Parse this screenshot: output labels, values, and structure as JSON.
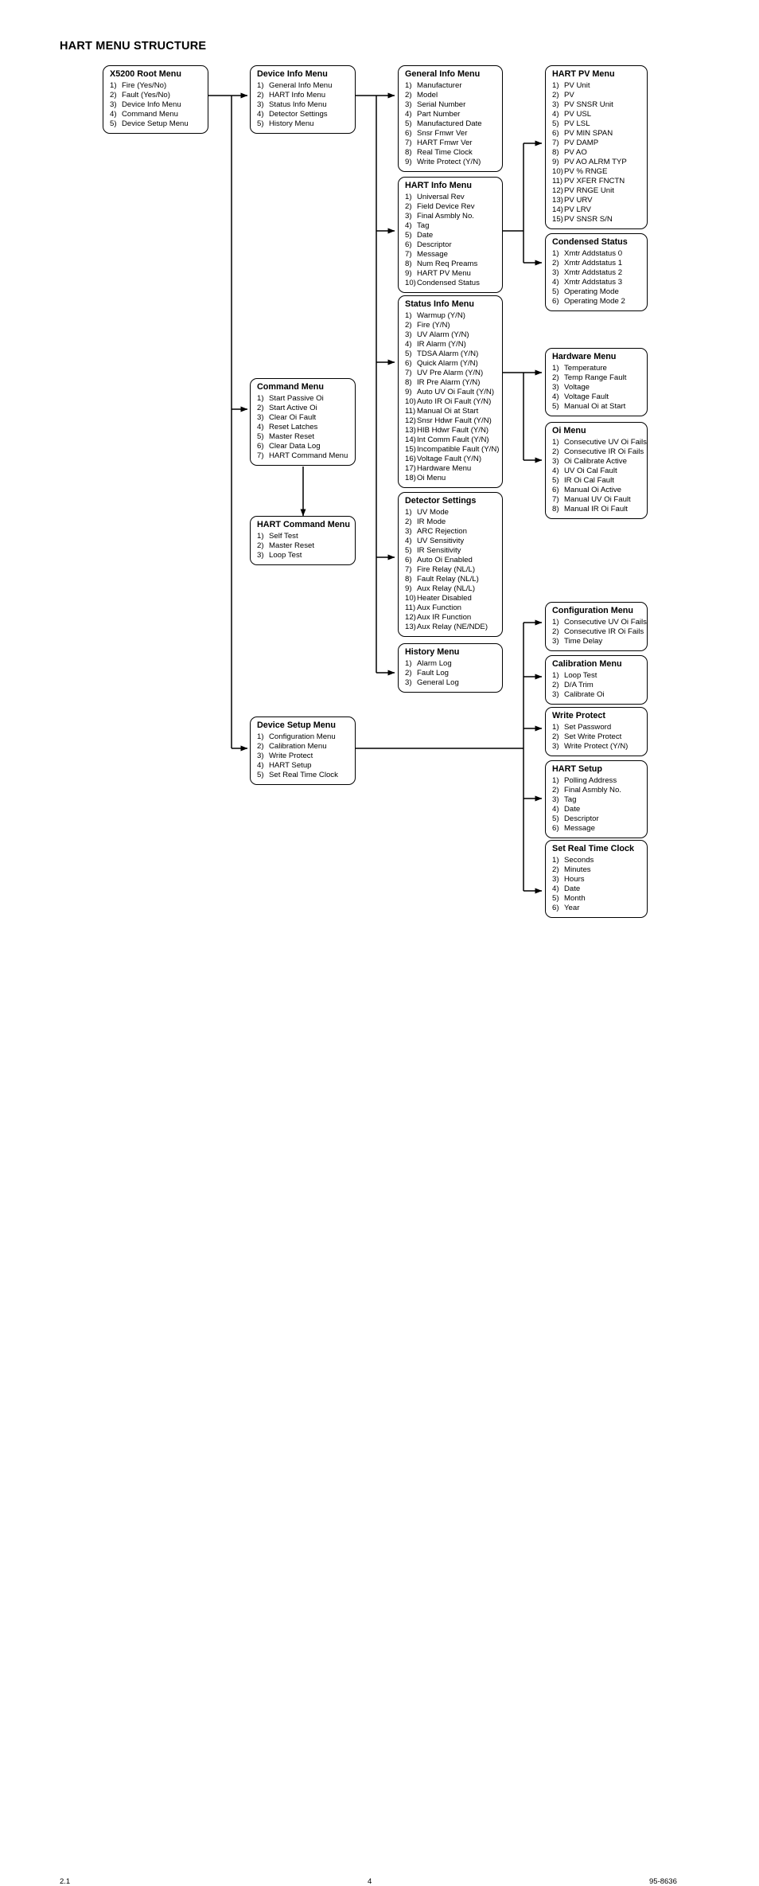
{
  "page": {
    "title": "HART MENU STRUCTURE",
    "footer": {
      "left": "2.1",
      "center": "4",
      "right": "95-8636"
    }
  },
  "diagram": {
    "type": "tree-menu-structure",
    "line_color": "#000000",
    "box_border_color": "#000000",
    "box_fill": "#ffffff",
    "nodes": [
      {
        "id": "root",
        "title": "X5200 Root Menu",
        "items": [
          {
            "num": "1)",
            "text": "Fire  (Yes/No)"
          },
          {
            "num": "2)",
            "text": "Fault  (Yes/No)"
          },
          {
            "num": "3)",
            "text": "Device Info Menu"
          },
          {
            "num": "4)",
            "text": "Command Menu"
          },
          {
            "num": "5)",
            "text": "Device Setup Menu"
          }
        ]
      },
      {
        "id": "device-info",
        "title": "Device Info Menu",
        "items": [
          {
            "num": "1)",
            "text": "General Info Menu"
          },
          {
            "num": "2)",
            "text": "HART Info Menu"
          },
          {
            "num": "3)",
            "text": "Status Info Menu"
          },
          {
            "num": "4)",
            "text": "Detector Settings"
          },
          {
            "num": "5)",
            "text": "History Menu"
          }
        ]
      },
      {
        "id": "general-info",
        "title": "General Info Menu",
        "items": [
          {
            "num": "1)",
            "text": "Manufacturer"
          },
          {
            "num": "2)",
            "text": "Model"
          },
          {
            "num": "3)",
            "text": "Serial Number"
          },
          {
            "num": "4)",
            "text": "Part Number"
          },
          {
            "num": "5)",
            "text": "Manufactured Date"
          },
          {
            "num": "6)",
            "text": "Snsr Fmwr Ver"
          },
          {
            "num": "7)",
            "text": "HART Fmwr Ver"
          },
          {
            "num": "8)",
            "text": "Real Time Clock"
          },
          {
            "num": "9)",
            "text": "Write Protect  (Y/N)"
          }
        ]
      },
      {
        "id": "hart-info",
        "title": "HART Info Menu",
        "items": [
          {
            "num": "1)",
            "text": "Universal Rev"
          },
          {
            "num": "2)",
            "text": "Field Device Rev"
          },
          {
            "num": "3)",
            "text": "Final Asmbly No."
          },
          {
            "num": "4)",
            "text": "Tag"
          },
          {
            "num": "5)",
            "text": "Date"
          },
          {
            "num": "6)",
            "text": "Descriptor"
          },
          {
            "num": "7)",
            "text": "Message"
          },
          {
            "num": "8)",
            "text": "Num Req Preams"
          },
          {
            "num": "9)",
            "text": "HART PV Menu"
          },
          {
            "num": "10)",
            "text": "Condensed Status"
          }
        ]
      },
      {
        "id": "hart-pv",
        "title": "HART PV Menu",
        "items": [
          {
            "num": "1)",
            "text": "PV Unit"
          },
          {
            "num": "2)",
            "text": "PV"
          },
          {
            "num": "3)",
            "text": "PV SNSR Unit"
          },
          {
            "num": "4)",
            "text": "PV USL"
          },
          {
            "num": "5)",
            "text": "PV LSL"
          },
          {
            "num": "6)",
            "text": "PV MIN SPAN"
          },
          {
            "num": "7)",
            "text": "PV DAMP"
          },
          {
            "num": "8)",
            "text": "PV AO"
          },
          {
            "num": "9)",
            "text": "PV AO ALRM TYP"
          },
          {
            "num": "10)",
            "text": "PV % RNGE"
          },
          {
            "num": "11)",
            "text": "PV XFER FNCTN"
          },
          {
            "num": "12)",
            "text": "PV RNGE Unit"
          },
          {
            "num": "13)",
            "text": "PV URV"
          },
          {
            "num": "14)",
            "text": "PV LRV"
          },
          {
            "num": "15)",
            "text": "PV SNSR S/N"
          }
        ]
      },
      {
        "id": "condensed-status",
        "title": "Condensed Status",
        "items": [
          {
            "num": "1)",
            "text": "Xmtr Addstatus 0"
          },
          {
            "num": "2)",
            "text": "Xmtr Addstatus 1"
          },
          {
            "num": "3)",
            "text": "Xmtr Addstatus 2"
          },
          {
            "num": "4)",
            "text": "Xmtr Addstatus 3"
          },
          {
            "num": "5)",
            "text": "Operating Mode"
          },
          {
            "num": "6)",
            "text": "Operating Mode 2"
          }
        ]
      },
      {
        "id": "status-info",
        "title": "Status Info Menu",
        "items": [
          {
            "num": "1)",
            "text": "Warmup  (Y/N)"
          },
          {
            "num": "2)",
            "text": "Fire (Y/N)"
          },
          {
            "num": "3)",
            "text": "UV Alarm (Y/N)"
          },
          {
            "num": "4)",
            "text": "IR Alarm (Y/N)"
          },
          {
            "num": "5)",
            "text": "TDSA Alarm (Y/N)"
          },
          {
            "num": "6)",
            "text": "Quick Alarm (Y/N)"
          },
          {
            "num": "7)",
            "text": "UV Pre Alarm (Y/N)"
          },
          {
            "num": "8)",
            "text": "IR Pre Alarm (Y/N)"
          },
          {
            "num": "9)",
            "text": "Auto UV Oi Fault  (Y/N)"
          },
          {
            "num": "10)",
            "text": "Auto IR Oi Fault (Y/N)"
          },
          {
            "num": "11)",
            "text": "Manual Oi at Start"
          },
          {
            "num": "12)",
            "text": "Snsr Hdwr Fault  (Y/N)"
          },
          {
            "num": "13)",
            "text": "HIB Hdwr Fault  (Y/N)"
          },
          {
            "num": "14)",
            "text": "Int Comm Fault (Y/N)"
          },
          {
            "num": "15)",
            "text": "Incompatible Fault (Y/N)"
          },
          {
            "num": "16)",
            "text": "Voltage Fault  (Y/N)"
          },
          {
            "num": "17)",
            "text": "Hardware Menu"
          },
          {
            "num": "18)",
            "text": "Oi Menu"
          }
        ]
      },
      {
        "id": "hardware",
        "title": "Hardware Menu",
        "items": [
          {
            "num": "1)",
            "text": "Temperature"
          },
          {
            "num": "2)",
            "text": "Temp Range Fault"
          },
          {
            "num": "3)",
            "text": "Voltage"
          },
          {
            "num": "4)",
            "text": "Voltage Fault"
          },
          {
            "num": "5)",
            "text": "Manual Oi at Start"
          }
        ]
      },
      {
        "id": "oi",
        "title": "Oi Menu",
        "items": [
          {
            "num": "1)",
            "text": "Consecutive UV Oi Fails"
          },
          {
            "num": "2)",
            "text": "Consecutive IR Oi Fails"
          },
          {
            "num": "3)",
            "text": "Oi Calibrate Active"
          },
          {
            "num": "4)",
            "text": "UV Oi Cal Fault"
          },
          {
            "num": "5)",
            "text": "IR Oi Cal Fault"
          },
          {
            "num": "6)",
            "text": "Manual Oi Active"
          },
          {
            "num": "7)",
            "text": "Manual UV Oi Fault"
          },
          {
            "num": "8)",
            "text": "Manual IR Oi Fault"
          }
        ]
      },
      {
        "id": "command",
        "title": "Command Menu",
        "items": [
          {
            "num": "1)",
            "text": "Start Passive Oi"
          },
          {
            "num": "2)",
            "text": "Start Active Oi"
          },
          {
            "num": "3)",
            "text": "Clear Oi Fault"
          },
          {
            "num": "4)",
            "text": "Reset Latches"
          },
          {
            "num": "5)",
            "text": "Master Reset"
          },
          {
            "num": "6)",
            "text": "Clear Data Log"
          },
          {
            "num": "7)",
            "text": "HART Command Menu"
          }
        ]
      },
      {
        "id": "hart-command",
        "title": "HART Command Menu",
        "items": [
          {
            "num": "1)",
            "text": "Self Test"
          },
          {
            "num": "2)",
            "text": "Master Reset"
          },
          {
            "num": "3)",
            "text": "Loop Test"
          }
        ]
      },
      {
        "id": "detector-settings",
        "title": "Detector Settings",
        "items": [
          {
            "num": "1)",
            "text": "UV Mode"
          },
          {
            "num": "2)",
            "text": "IR Mode"
          },
          {
            "num": "3)",
            "text": "ARC Rejection"
          },
          {
            "num": "4)",
            "text": "UV Sensitivity"
          },
          {
            "num": "5)",
            "text": "IR Sensitivity"
          },
          {
            "num": "6)",
            "text": "Auto Oi Enabled"
          },
          {
            "num": "7)",
            "text": "Fire Relay (NL/L)"
          },
          {
            "num": "8)",
            "text": "Fault Relay (NL/L)"
          },
          {
            "num": "9)",
            "text": "Aux Relay  (NL/L)"
          },
          {
            "num": "10)",
            "text": "Heater Disabled"
          },
          {
            "num": "11)",
            "text": "Aux Function"
          },
          {
            "num": "12)",
            "text": "Aux IR Function"
          },
          {
            "num": "13)",
            "text": "Aux Relay  (NE/NDE)"
          }
        ]
      },
      {
        "id": "history",
        "title": "History Menu",
        "items": [
          {
            "num": "1)",
            "text": "Alarm Log"
          },
          {
            "num": "2)",
            "text": "Fault Log"
          },
          {
            "num": "3)",
            "text": "General Log"
          }
        ]
      },
      {
        "id": "device-setup",
        "title": "Device Setup Menu",
        "items": [
          {
            "num": "1)",
            "text": "Configuration Menu"
          },
          {
            "num": "2)",
            "text": "Calibration Menu"
          },
          {
            "num": "3)",
            "text": "Write Protect"
          },
          {
            "num": "4)",
            "text": "HART Setup"
          },
          {
            "num": "5)",
            "text": "Set Real Time Clock"
          }
        ]
      },
      {
        "id": "configuration",
        "title": "Configuration Menu",
        "items": [
          {
            "num": "1)",
            "text": "Consecutive UV Oi Fails"
          },
          {
            "num": "2)",
            "text": "Consecutive IR Oi Fails"
          },
          {
            "num": "3)",
            "text": "Time Delay"
          }
        ]
      },
      {
        "id": "calibration",
        "title": "Calibration Menu",
        "items": [
          {
            "num": "1)",
            "text": "Loop Test"
          },
          {
            "num": "2)",
            "text": "D/A Trim"
          },
          {
            "num": "3)",
            "text": "Calibrate Oi"
          }
        ]
      },
      {
        "id": "write-protect",
        "title": "Write Protect",
        "items": [
          {
            "num": "1)",
            "text": "Set Password"
          },
          {
            "num": "2)",
            "text": "Set Write Protect"
          },
          {
            "num": "3)",
            "text": "Write Protect  (Y/N)"
          }
        ]
      },
      {
        "id": "hart-setup",
        "title": "HART Setup",
        "items": [
          {
            "num": "1)",
            "text": "Polling Address"
          },
          {
            "num": "2)",
            "text": "Final Asmbly No."
          },
          {
            "num": "3)",
            "text": "Tag"
          },
          {
            "num": "4)",
            "text": "Date"
          },
          {
            "num": "5)",
            "text": "Descriptor"
          },
          {
            "num": "6)",
            "text": "Message"
          }
        ]
      },
      {
        "id": "set-real-time-clock",
        "title": "Set Real Time Clock",
        "items": [
          {
            "num": "1)",
            "text": "Seconds"
          },
          {
            "num": "2)",
            "text": "Minutes"
          },
          {
            "num": "3)",
            "text": "Hours"
          },
          {
            "num": "4)",
            "text": "Date"
          },
          {
            "num": "5)",
            "text": "Month"
          },
          {
            "num": "6)",
            "text": "Year"
          }
        ]
      }
    ],
    "edges": [
      {
        "from": "root",
        "to": "device-info"
      },
      {
        "from": "root",
        "to": "command"
      },
      {
        "from": "root",
        "to": "device-setup"
      },
      {
        "from": "device-info",
        "to": "general-info"
      },
      {
        "from": "device-info",
        "to": "hart-info"
      },
      {
        "from": "device-info",
        "to": "status-info"
      },
      {
        "from": "device-info",
        "to": "detector-settings"
      },
      {
        "from": "device-info",
        "to": "history"
      },
      {
        "from": "hart-info",
        "to": "hart-pv"
      },
      {
        "from": "hart-info",
        "to": "condensed-status"
      },
      {
        "from": "status-info",
        "to": "hardware"
      },
      {
        "from": "status-info",
        "to": "oi"
      },
      {
        "from": "command",
        "to": "hart-command"
      },
      {
        "from": "device-setup",
        "to": "configuration"
      },
      {
        "from": "device-setup",
        "to": "calibration"
      },
      {
        "from": "device-setup",
        "to": "write-protect"
      },
      {
        "from": "device-setup",
        "to": "hart-setup"
      },
      {
        "from": "device-setup",
        "to": "set-real-time-clock"
      }
    ]
  }
}
